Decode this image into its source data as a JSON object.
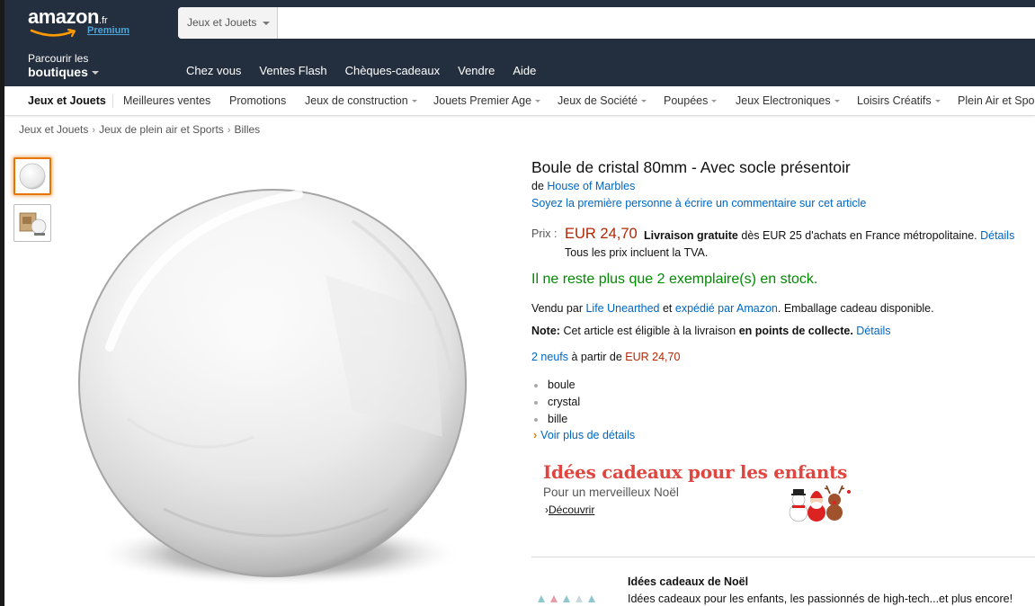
{
  "header": {
    "logo_word": "amazon",
    "logo_tld": ".fr",
    "logo_premium": "Premium",
    "search_category": "Jeux et Jouets",
    "search_value": "",
    "shop_small": "Parcourir les",
    "shop_big": "boutiques",
    "nav": [
      "Chez vous",
      "Ventes Flash",
      "Chèques-cadeaux",
      "Vendre",
      "Aide"
    ]
  },
  "subnav": {
    "items": [
      "Jeux et Jouets",
      "Meilleures ventes",
      "Promotions",
      "Jeux de construction",
      "Jouets Premier Age",
      "Jeux de Société",
      "Poupées",
      "Jeux Electroniques",
      "Loisirs Créatifs",
      "Plein Air et Sports"
    ]
  },
  "breadcrumb": [
    "Jeux et Jouets",
    "Jeux de plein air et Sports",
    "Billes"
  ],
  "product": {
    "title": "Boule de cristal 80mm - Avec socle présentoir",
    "by_prefix": "de",
    "brand": "House of Marbles",
    "review_link": "Soyez la première personne à écrire un commentaire sur cet article",
    "price_label": "Prix :",
    "price": "EUR 24,70",
    "shipping_bold": "Livraison gratuite",
    "shipping_text": "dès EUR 25 d'achats en France métropolitaine.",
    "shipping_link": "Détails",
    "tva": "Tous les prix incluent la TVA.",
    "stock": "Il ne reste plus que 2 exemplaire(s) en stock.",
    "sold_prefix": "Vendu par",
    "seller": "Life Unearthed",
    "sold_and": "et",
    "shipped_by": "expédié par Amazon",
    "sold_suffix": ". Emballage cadeau disponible.",
    "note_label": "Note:",
    "note_text": "Cet article est éligible à la livraison",
    "note_bold": "en points de collecte.",
    "note_link": "Détails",
    "offers_link": "2 neufs",
    "offers_text": "à partir de",
    "offers_price": "EUR 24,70",
    "bullets": [
      "boule",
      "crystal",
      "bille"
    ],
    "more_details": "Voir plus de détails"
  },
  "promo": {
    "title": "Idées cadeaux pour les enfants",
    "subtitle": "Pour un merveilleux Noël",
    "link": "Découvrir"
  },
  "gift": {
    "title": "Idées cadeaux de Noël",
    "text": "Idées cadeaux pour les enfants, les passionnés de high-tech...et plus encore!"
  },
  "colors": {
    "header_bg": "#232f3e",
    "link": "#0066c0",
    "price": "#b12704",
    "stock": "#008a00",
    "promo_title": "#e0463f",
    "thumb_selected": "#e77600"
  }
}
